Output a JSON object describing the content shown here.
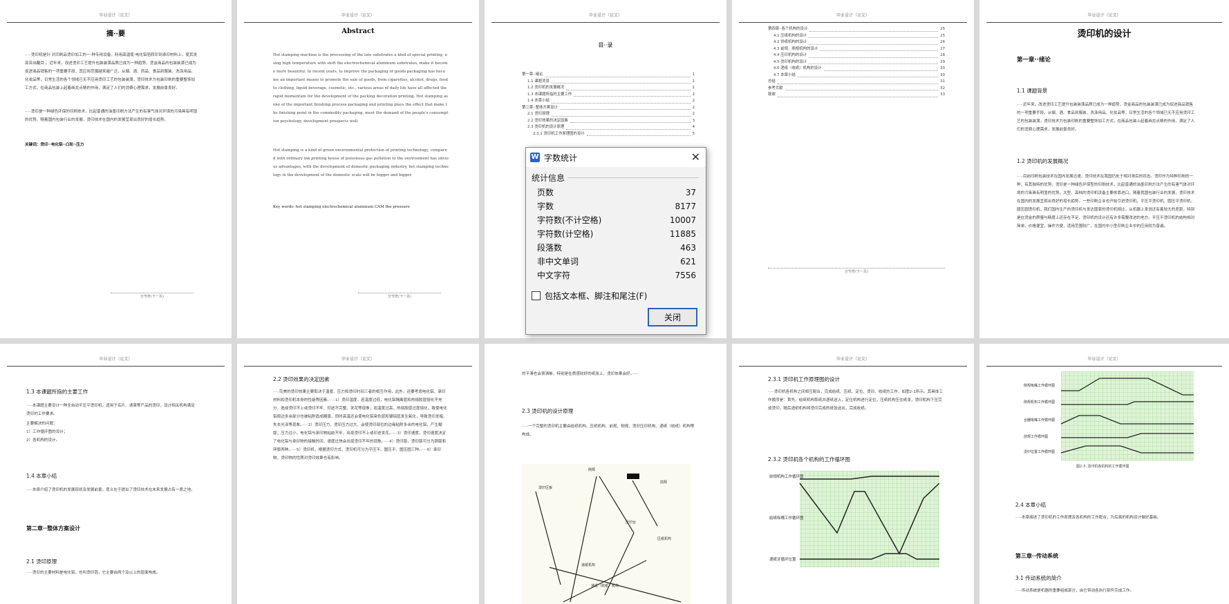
{
  "header_text": "毕业设计（论文）",
  "footer_text": "分节符(下一页)",
  "page1": {
    "title": "摘··要",
    "para1": "·····烫印机是针·对印刷品烫印加工的一·种专用设备，利用高温使·电化铝箔转印到承印材料上，使其发亮突出醒目·。近年来，改进烫印工艺提升包装装潢品质已成为一种趋势，烫金商品的包装装潢已成为促进商品销售的一项重要手段，其应用范围越来越广泛，从烟、酒、药品、食品到服装、洗涤用品、化妆品等，日常生活的各个领域已无不应用烫印工艺的包装装潢，烫印技术为包装印刷的重要整饰加工方式，在商品包装上起着画龙点睛的作用，满足了人们的消费心理需求，发展前景良好。",
    "para2": "·····烫印是一种绿色环保的印刷技术，比起普通的油墨印刷方法产生的有害气体对环境的污染具有明显的优势。随着国内包装行业的发展，烫印技术在国内的发展呈现出良好的增长趋势。",
    "keywords": "关键词：烫印··电化铝··凸轮··压力"
  },
  "page2": {
    "title": "Abstract",
    "para1": "Hot stamping machine is the processing of the late substrates a kind of special printing, using high temperature with shift the electrochemical aluminum substrates, make it become more beautiful. In recent years, to improve the packaging of goods packaging has become an important means to promote the sale of goods, from cigarettes, alcohol, drugs, food to clothing, liquid beverage, cosmetic, etc., various areas of daily life have all affected the rapid momentum for the development of the packing decoration printing. Hot stamping as one of the important finishing process packaging and printing plays the effect that make the finishing point in the commodity packaging, meet the demand of the people's consumption psychology, development prospects well.",
    "para2": "Hot stamping is a kind of green environmental protection of printing technology, compared with ordinary ink printing house of poisonous gas pollution to the environment has obvious advantages, with the development of domestic packaging industry, hot stamping technology in the development of the domestic scale will be bigger and bigger.",
    "keywords": "Key words: hot stamping  electrochemical aluminum  CAM  the pressure"
  },
  "page3": {
    "title": "目··录",
    "toc": [
      {
        "t": "第一章··绪论",
        "p": "1"
      },
      {
        "t": "1.1 课题背景",
        "p": "1"
      },
      {
        "t": "1.2 烫印机的发展概况",
        "p": "1"
      },
      {
        "t": "1.3 本课题所指的主要工作",
        "p": "2"
      },
      {
        "t": "1.4 本章小结",
        "p": "2"
      },
      {
        "t": "第二章··整体方案设计",
        "p": "2"
      },
      {
        "t": "2.1 烫印原理",
        "p": "2"
      },
      {
        "t": "2.2 烫印效果的决定因素",
        "p": "3"
      },
      {
        "t": "2.3 烫印机的设计原理",
        "p": "4"
      },
      {
        "t": "2.3.1 烫印机工作原理图的设计",
        "p": "5"
      }
    ]
  },
  "page4": {
    "toc": [
      {
        "t": "第四章··各个机构的设计",
        "p": "25"
      },
      {
        "t": "4.1 压纸机构的设计",
        "p": "25"
      },
      {
        "t": "4.2 供纸机构的设计",
        "p": "26"
      },
      {
        "t": "4.3 前规、侧规机构的设计",
        "p": "27"
      },
      {
        "t": "4.4 压印机构的设计",
        "p": "28"
      },
      {
        "t": "4.5 烫印机构的设计",
        "p": "29"
      },
      {
        "t": "4.6 递纸（收纸）机构的设计",
        "p": "30"
      },
      {
        "t": "4.7 本章小结",
        "p": "30"
      },
      {
        "t": "总结",
        "p": "31"
      },
      {
        "t": "参考文献",
        "p": "32"
      },
      {
        "t": "致谢",
        "p": "33"
      }
    ]
  },
  "page5": {
    "title": "烫印机的设计",
    "ch1": "第一章··绪论",
    "s11": "1.1 课题背景",
    "p11": "·····近年来，改进烫印工艺提升包装装潢品质已成为一种趋势，烫金商品的包装装潢已成为促进商品销售的一项重要手段，从烟、酒、食品到服装、洗涤用品、化妆品等，日常生活的各个领域已无不应用烫印工艺的包装装潢，烫印技术为包装印刷的重要整饰加工方式，在商品包装上起着画龙点睛的作用，满足了人们的消费心理需求，发展前景良好。",
    "s12": "1.2 烫印机的发展概况",
    "p12": "·····目前印刷包装技术在国内发展迅速，烫印技术在我国仍处于相对滞后的状态。烫印作为特种印刷的一种，有其独特的优势。烫印是一种绿色环保型的印刷技术，比起普通的油墨印刷方法产生的有害气体对环境的污染具有明显的优势。大型、高档的烫印机设备主要依靠进口，随着我国包装行业的发展，烫印技术在国内的发展呈现出良好的增长趋势，一些印刷企业也开始引进烫印机，平压平烫印机、圆压平烫印机、圆压圆烫印机，我们国内生产的烫印机与发达国家的烫印机相比，从机器上来说还有着较大的差距，特别是在烫金的质量与精度上还存在不足，烫印机的设计还有许多需要改进的地方。平压平烫印机的结构相对简单，价格便宜，操作方便，适用范围较广，在国内中小型印刷企业中的应用较为普遍。"
  },
  "page6": {
    "s13": "1.3 本课题所指的主要工作",
    "p13": "·····本课题主要设计一种全自动平压平烫印机，适用于名片、请柬等产品的烫印，设计相关机构满足烫印的工作要求。",
    "items": [
      "主要解决的问题：",
      "1）工作循环图的设计；",
      "2）各机构的设计。"
    ],
    "s14": "1.4 本章小结",
    "p14": "·····本章介绍了烫印机的发展现状及发展前景，意义在于提出了烫印技术在未来发展占有一席之地。",
    "ch2": "第二章··整体方案设计",
    "s21": "2.1 烫印原理",
    "p21": "·····烫印的主要材料是电化铝，也叫烫印箔，它主要由两个及以上的层面构成。"
  },
  "page7": {
    "s22": "2.2 烫印效果的决定因素",
    "p22": "·····完美的烫印效果主要取决于温度、压力和烫印时间三者的相互作用，此外，还要考虑电化铝、承印材料和烫印机本身的性能等因素。·····1）烫印温度，若温度过低，电化铝隔离层和热熔胶层熔化不充分，造成烫印不上或烫印不牢、印迹不完整、发花等现象；若温度过高，热熔胶层过度熔化，致使电化铝周边多余部分也被粘附造成糊版，同时高温还会使电化铝染色层和镀铝层发生氧化，导致烫印发暗、失去光泽等现象。·····2）烫印压力，烫印压力过大，会使烫印部位的边缘粘附多余的电化铝，产生糊版；压力过小，电化铝与承印物粘结不牢，出现烫印不上或印迹发花。·····3）烫印速度，烫印速度决定了电化铝与承印物的接触时间，速度过快会出现烫印不牢的现象。·····4）烫印版，烫印版可分为铜版和锌版两种。·····5）烫印机，根据烫印方式，烫印机可分为平压平、圆压平、圆压圆三种。·····6）承印物，烫印物的性质对烫印效果也有影响。"
  },
  "page8": {
    "top": "的平滑也会很清晰，特别是在质感较好的纸张上，烫印效果会好。·····",
    "s23": "2.3 烫印机的设计原理",
    "p23": "·····一个完整的烫印机主要由给纸机构、压纸机构、前规、侧规、烫印压印机构、递纸（收纸）机构等构成。",
    "labels": [
      "侧规",
      "前规",
      "烫印压板",
      "压印台",
      "压纸机构",
      "递纸机构",
      "前规",
      "递纸（收纸）机构"
    ]
  },
  "page9": {
    "s231": "2.3.1 烫印机工作原理图的设计",
    "p231": "·····烫印机各机构之间相互配合，完成给纸、压纸、定位、烫印、收纸的工作，如图2-1所示。其具体工作顺序是：首先，给纸机构取纸并递纸送入，定位机构进行定位，压纸机构压住纸张，烫印机构下压完成烫印，随后递纸机构将烫印完成的纸张送出，完成收纸。",
    "s232": "2.3.2 烫印机各个机构的工作循环图",
    "chart_labels": [
      "前规机构工作循环图",
      "给纸吸嘴工作循环图",
      "递纸牙循环位置"
    ]
  },
  "page10": {
    "chart_labels": [
      "侧规吸嘴工作循环图",
      "侧规机构工作循环图",
      "合器吸嘴工作循环图",
      "前规工作循环图",
      "烫印位置工作循环图"
    ],
    "caption": "图2-3··烫印机各机构的工作循环图",
    "s24": "2.4 本章小结",
    "p24": "·····本章阐述了烫印机的工作原理及各机构的工作配合，为后面的机构设计做好基础。",
    "ch3": "第三章··传动系统",
    "s31": "3.1 传动系统的简介",
    "p31": "·····传动系统是机器的重要组成部分，由它带动各执行部件完成工作。"
  },
  "dialog": {
    "title": "字数统计",
    "group": "统计信息",
    "stats": [
      {
        "label": "页数",
        "value": "37"
      },
      {
        "label": "字数",
        "value": "8177"
      },
      {
        "label": "字符数(不计空格)",
        "value": "10007"
      },
      {
        "label": "字符数(计空格)",
        "value": "11885"
      },
      {
        "label": "段落数",
        "value": "463"
      },
      {
        "label": "非中文单词",
        "value": "621"
      },
      {
        "label": "中文字符",
        "value": "7556"
      }
    ],
    "checkbox": "包括文本框、脚注和尾注(F)",
    "close": "关闭"
  }
}
